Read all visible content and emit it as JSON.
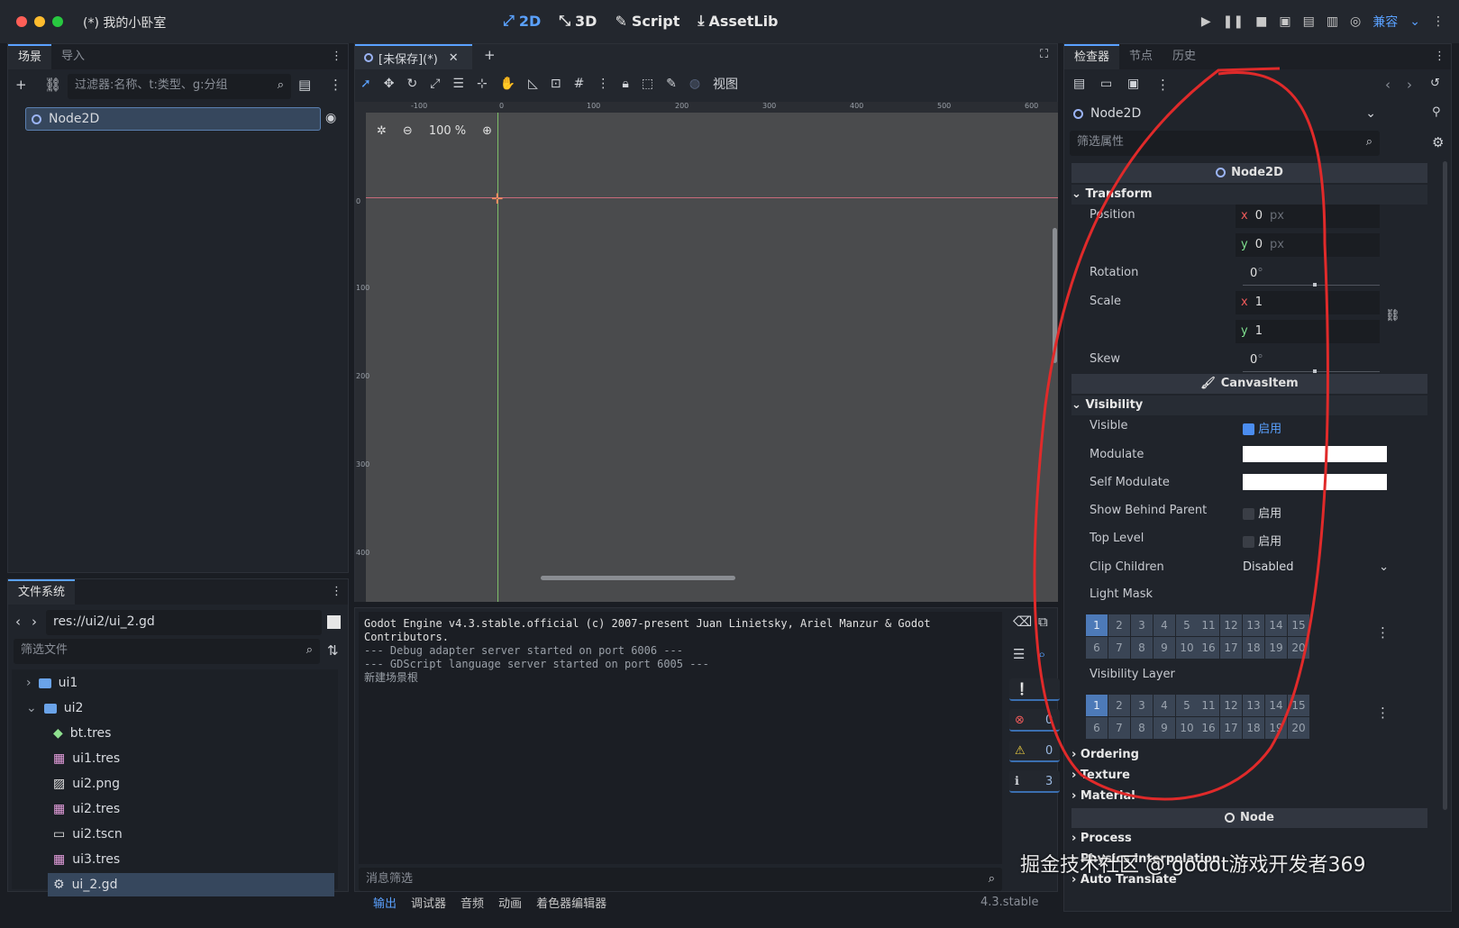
{
  "window": {
    "title": "(*) 我的小卧室"
  },
  "main_tabs": [
    {
      "label": "2D",
      "icon": "2d-icon"
    },
    {
      "label": "3D",
      "icon": "3d-icon"
    },
    {
      "label": "Script",
      "icon": "script-icon"
    },
    {
      "label": "AssetLib",
      "icon": "assetlib-icon"
    }
  ],
  "renderer": {
    "label": "兼容"
  },
  "scene_dock": {
    "tabs": [
      "场景",
      "导入"
    ],
    "filter_placeholder": "过滤器:名称、t:类型、g:分组",
    "root_node": "Node2D"
  },
  "viewport": {
    "tab_label": "[未保存](*)",
    "zoom": "100 %",
    "view_menu": "视图",
    "ruler_top": [
      "-100",
      "0",
      "100",
      "200",
      "300",
      "400",
      "500",
      "600"
    ],
    "ruler_left": [
      "0",
      "100",
      "200",
      "300",
      "400"
    ]
  },
  "filesystem": {
    "tab": "文件系统",
    "path": "res://ui2/ui_2.gd",
    "filter_placeholder": "筛选文件",
    "items": [
      {
        "name": "ui1",
        "type": "folder",
        "indent": 0,
        "expanded": false
      },
      {
        "name": "ui2",
        "type": "folder",
        "indent": 0,
        "expanded": true
      },
      {
        "name": "bt.tres",
        "type": "resource",
        "indent": 1
      },
      {
        "name": "ui1.tres",
        "type": "resource",
        "indent": 1
      },
      {
        "name": "ui2.png",
        "type": "image",
        "indent": 1
      },
      {
        "name": "ui2.tres",
        "type": "resource",
        "indent": 1
      },
      {
        "name": "ui2.tscn",
        "type": "scene",
        "indent": 1
      },
      {
        "name": "ui3.tres",
        "type": "resource",
        "indent": 1
      },
      {
        "name": "ui_2.gd",
        "type": "script",
        "indent": 1,
        "selected": true
      }
    ]
  },
  "console": {
    "lines": [
      "Godot Engine v4.3.stable.official (c) 2007-present Juan Linietsky, Ariel Manzur & Godot",
      "Contributors.",
      "--- Debug adapter server started on port 6006 ---",
      "--- GDScript language server started on port 6005 ---",
      "新建场景根"
    ],
    "filter_placeholder": "消息筛选",
    "counts": {
      "errors": "0",
      "warnings": "0",
      "info": "3"
    }
  },
  "bottom_tabs": [
    "输出",
    "调试器",
    "音频",
    "动画",
    "着色器编辑器"
  ],
  "version": "4.3.stable",
  "inspector": {
    "tabs": [
      "检查器",
      "节点",
      "历史"
    ],
    "object_name": "Node2D",
    "filter_placeholder": "筛选属性",
    "class_header": "Node2D",
    "transform_section": "Transform",
    "position": {
      "label": "Position",
      "x": "0",
      "y": "0",
      "unit": "px"
    },
    "rotation": {
      "label": "Rotation",
      "value": "0",
      "unit": "°"
    },
    "scale": {
      "label": "Scale",
      "x": "1",
      "y": "1"
    },
    "skew": {
      "label": "Skew",
      "value": "0",
      "unit": "°"
    },
    "canvas_header": "CanvasItem",
    "visibility_section": "Visibility",
    "visible": {
      "label": "Visible",
      "value": "启用"
    },
    "modulate": {
      "label": "Modulate"
    },
    "self_modulate": {
      "label": "Self Modulate"
    },
    "show_behind_parent": {
      "label": "Show Behind Parent",
      "value": "启用"
    },
    "top_level": {
      "label": "Top Level",
      "value": "启用"
    },
    "clip_children": {
      "label": "Clip Children",
      "value": "Disabled"
    },
    "light_mask": {
      "label": "Light Mask"
    },
    "visibility_layer": {
      "label": "Visibility Layer"
    },
    "layer_numbers": [
      "1",
      "2",
      "3",
      "4",
      "5",
      "11",
      "12",
      "13",
      "14",
      "15",
      "6",
      "7",
      "8",
      "9",
      "10",
      "16",
      "17",
      "18",
      "19",
      "20"
    ],
    "ordering": "Ordering",
    "texture": "Texture",
    "material": "Material",
    "node_header": "Node",
    "process": "Process",
    "physics_interp": "Physics Interpolation",
    "auto_translate": "Auto Translate"
  },
  "watermark": "掘金技术社区 @ godot游戏开发者369",
  "colors": {
    "accent": "#5aa1ff",
    "annotation": "#e02a2a"
  }
}
